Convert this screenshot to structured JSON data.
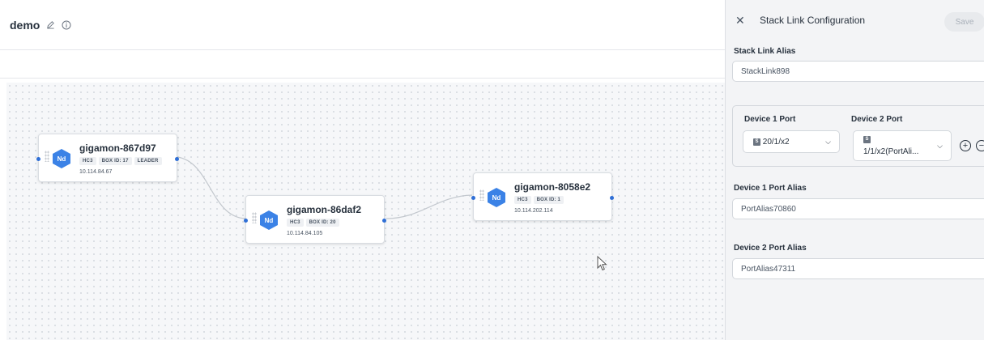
{
  "header": {
    "title": "demo",
    "edit_icon": "pencil-icon",
    "info_icon": "info-icon"
  },
  "nodes": [
    {
      "name": "gigamon-867d97",
      "type_label": "Nd",
      "tags": [
        "HC3",
        "BOX ID: 17",
        "LEADER"
      ],
      "ip": "10.114.84.67"
    },
    {
      "name": "gigamon-86daf2",
      "type_label": "Nd",
      "tags": [
        "HC3",
        "BOX ID: 20"
      ],
      "ip": "10.114.84.105"
    },
    {
      "name": "gigamon-8058e2",
      "type_label": "Nd",
      "tags": [
        "HC3",
        "BOX ID: 1"
      ],
      "ip": "10.114.202.114"
    }
  ],
  "panel": {
    "title": "Stack Link Configuration",
    "save_label": "Save",
    "alias_label": "Stack Link Alias",
    "alias_value": "StackLink898",
    "device1_port_label": "Device 1 Port",
    "device2_port_label": "Device 2 Port",
    "device1_port_value": "20/1/x2",
    "device2_port_value": "1/1/x2(PortAli...",
    "port_badge": "S",
    "device1_alias_label": "Device 1 Port Alias",
    "device1_alias_value": "PortAlias70860",
    "device2_alias_label": "Device 2 Port Alias",
    "device2_alias_value": "PortAlias47311"
  },
  "colors": {
    "accent": "#3b82e6",
    "link": "#2f6fd6"
  }
}
